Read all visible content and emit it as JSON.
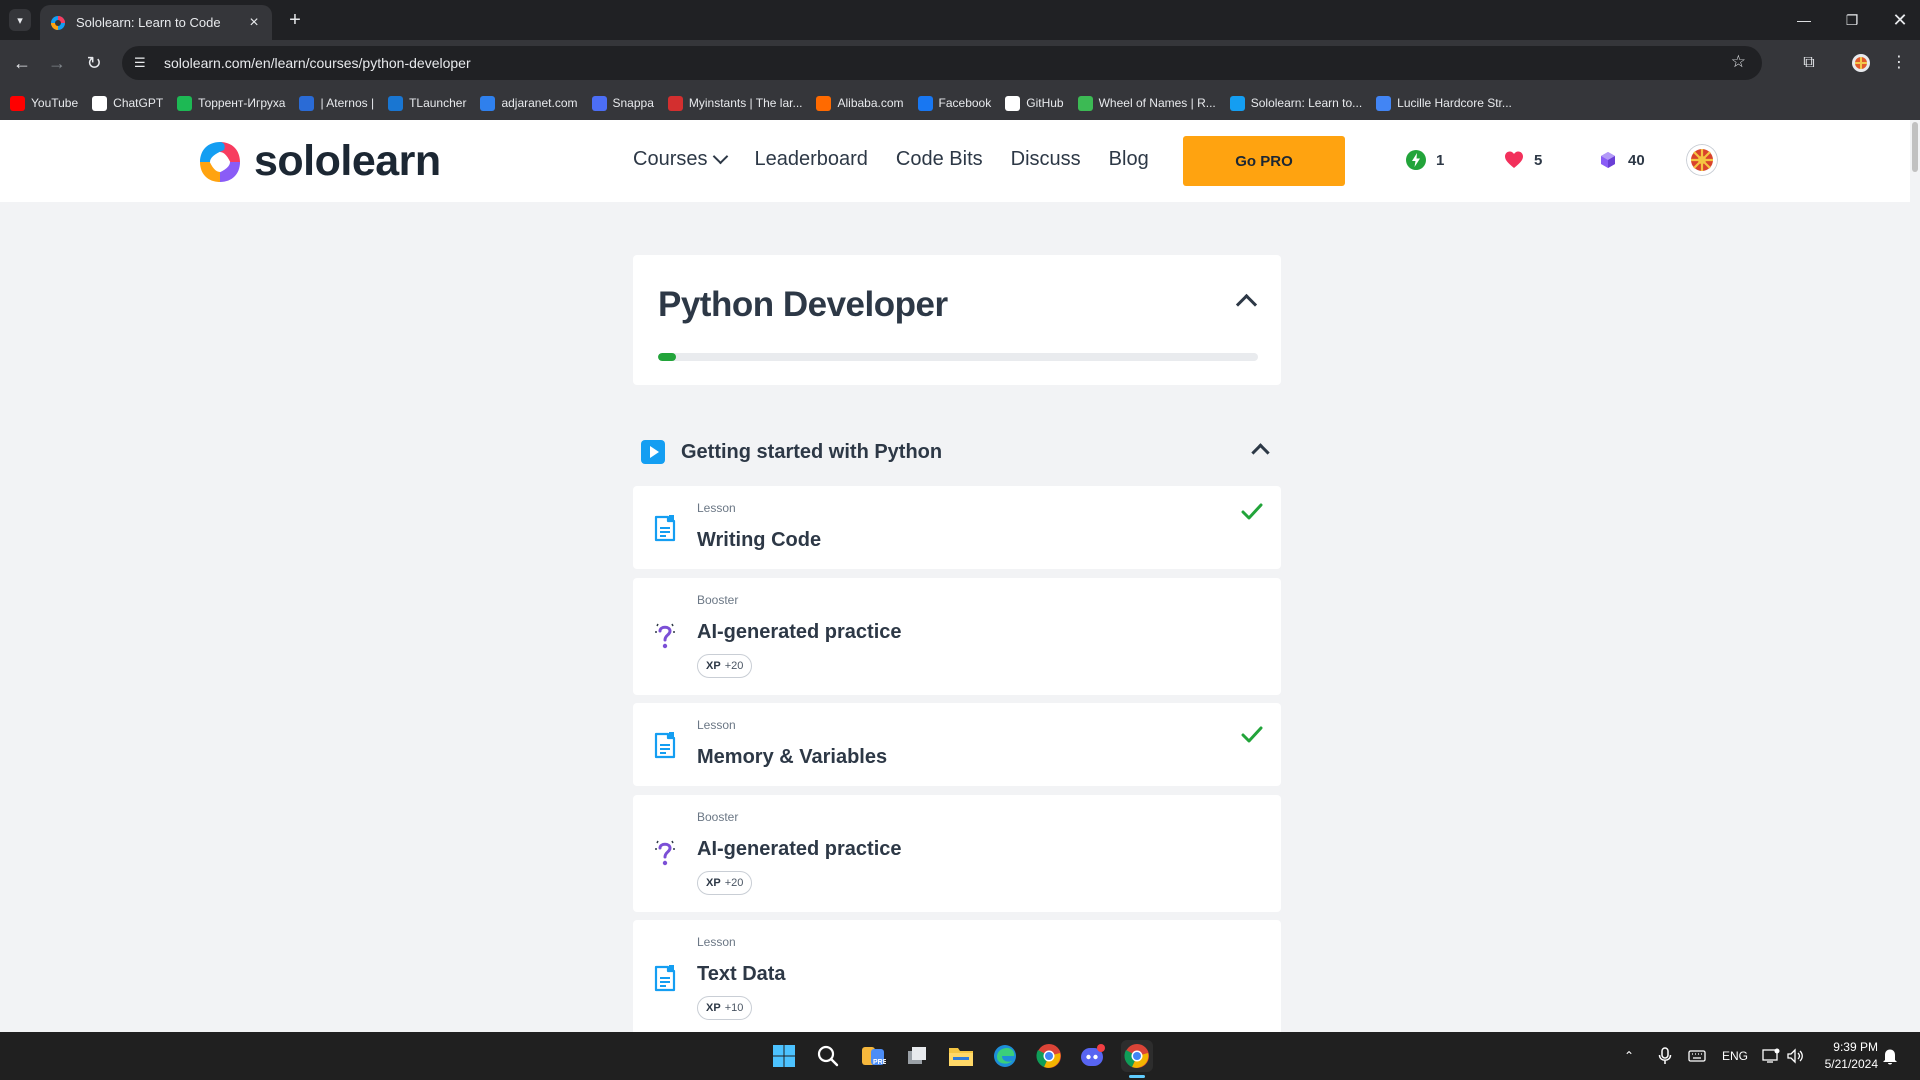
{
  "browser": {
    "tab_title": "Sololearn: Learn to Code",
    "url": "sololearn.com/en/learn/courses/python-developer",
    "bookmarks": [
      {
        "label": "YouTube",
        "icon": "youtube-icon",
        "color": "#ff0000"
      },
      {
        "label": "ChatGPT",
        "icon": "chatgpt-icon",
        "color": "#ffffff"
      },
      {
        "label": "Торрент-Игруха",
        "icon": "torrent-igruha-icon",
        "color": "#1db954"
      },
      {
        "label": "| Aternos |",
        "icon": "aternos-icon",
        "color": "#2a6bd6"
      },
      {
        "label": "TLauncher",
        "icon": "tlauncher-icon",
        "color": "#1976d2"
      },
      {
        "label": "adjaranet.com",
        "icon": "adjaranet-icon",
        "color": "#2f80ed"
      },
      {
        "label": "Snappa",
        "icon": "snappa-icon",
        "color": "#4c6ef5"
      },
      {
        "label": "Myinstants | The lar...",
        "icon": "myinstants-icon",
        "color": "#d32f2f"
      },
      {
        "label": "Alibaba.com",
        "icon": "alibaba-icon",
        "color": "#ff6a00"
      },
      {
        "label": "Facebook",
        "icon": "facebook-icon",
        "color": "#1877f2"
      },
      {
        "label": "GitHub",
        "icon": "github-icon",
        "color": "#ffffff"
      },
      {
        "label": "Wheel of Names | R...",
        "icon": "wheel-of-names-icon",
        "color": "#3cba54"
      },
      {
        "label": "Sololearn: Learn to...",
        "icon": "sololearn-icon",
        "color": "#149ef2"
      },
      {
        "label": "Lucille Hardcore Str...",
        "icon": "google-docs-icon",
        "color": "#4285f4"
      }
    ]
  },
  "header": {
    "logo_text": "sololearn",
    "nav": {
      "courses": "Courses",
      "leaderboard": "Leaderboard",
      "code_bits": "Code Bits",
      "discuss": "Discuss",
      "blog": "Blog"
    },
    "go_pro": "Go PRO",
    "streak": "1",
    "hearts": "5",
    "gems": "40"
  },
  "course": {
    "title": "Python Developer",
    "progress": 0.03
  },
  "module": {
    "title": "Getting started with Python"
  },
  "items": [
    {
      "kind": "Lesson",
      "name": "Writing Code",
      "completed": true
    },
    {
      "kind": "Booster",
      "name": "AI-generated practice",
      "xp_label": "XP",
      "xp_value": "+20"
    },
    {
      "kind": "Lesson",
      "name": "Memory & Variables",
      "completed": true
    },
    {
      "kind": "Booster",
      "name": "AI-generated practice",
      "xp_label": "XP",
      "xp_value": "+20"
    },
    {
      "kind": "Lesson",
      "name": "Text Data",
      "xp_label": "XP",
      "xp_value": "+10"
    }
  ],
  "taskbar": {
    "language": "ENG",
    "time": "9:39 PM",
    "date": "5/21/2024"
  },
  "colors": {
    "brand_orange": "#ffa310",
    "progress_green": "#22a43a",
    "lesson_blue": "#149ef2",
    "booster_purple": "#7b4fd6",
    "check_green": "#22a43a"
  }
}
